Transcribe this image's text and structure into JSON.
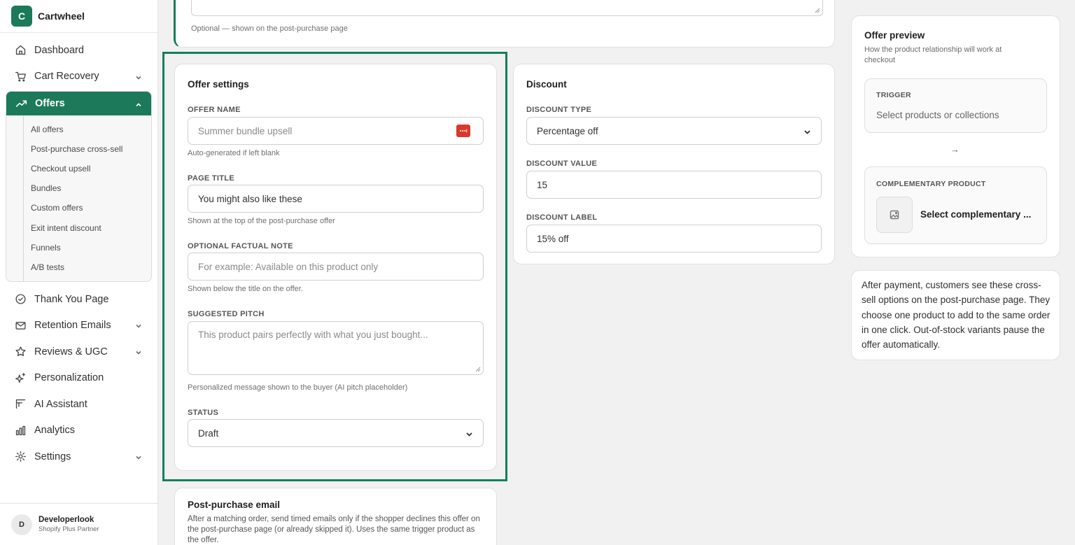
{
  "sidebar": {
    "brand_initial": "C",
    "brand_name": "Cartwheel",
    "items_top": [
      {
        "label": "Dashboard",
        "icon": "home-icon"
      },
      {
        "label": "Cart Recovery",
        "icon": "cart-icon",
        "expandable": true
      }
    ],
    "offers": {
      "label": "Offers",
      "icon": "trend-up-icon",
      "subitems": [
        "All offers",
        "Post-purchase cross-sell",
        "Checkout upsell",
        "Bundles",
        "Custom offers",
        "Exit intent discount",
        "Funnels",
        "A/B tests"
      ]
    },
    "items_bottom": [
      {
        "label": "Thank You Page",
        "icon": "check-circle-icon"
      },
      {
        "label": "Retention Emails",
        "icon": "mail-icon",
        "expandable": true
      },
      {
        "label": "Reviews & UGC",
        "icon": "star-icon",
        "expandable": true
      },
      {
        "label": "Personalization",
        "icon": "sparkle-icon"
      },
      {
        "label": "AI Assistant",
        "icon": "assistant-icon"
      },
      {
        "label": "Analytics",
        "icon": "bar-chart-icon"
      },
      {
        "label": "Settings",
        "icon": "gear-icon",
        "expandable": true
      }
    ],
    "user": {
      "initial": "D",
      "name": "Developerlook",
      "role": "Shopify Plus Partner"
    }
  },
  "top_card": {
    "help": "Optional — shown on the post-purchase page"
  },
  "offer_settings": {
    "title": "Offer settings",
    "offer_name": {
      "label": "Offer name",
      "placeholder": "Summer bundle upsell",
      "help": "Auto-generated if left blank"
    },
    "page_title": {
      "label": "Page title",
      "value": "You might also like these",
      "help": "Shown at the top of the post-purchase offer"
    },
    "factual_note": {
      "label": "Optional factual note",
      "placeholder": "For example: Available on this product only",
      "help": "Shown below the title on the offer."
    },
    "pitch": {
      "label": "Suggested pitch",
      "placeholder": "This product pairs perfectly with what you just bought...",
      "help": "Personalized message shown to the buyer (AI pitch placeholder)"
    },
    "status": {
      "label": "Status",
      "value": "Draft"
    }
  },
  "discount": {
    "title": "Discount",
    "type": {
      "label": "Discount type",
      "value": "Percentage off"
    },
    "value": {
      "label": "Discount value",
      "value": "15"
    },
    "discount_label": {
      "label": "Discount label",
      "value": "15% off"
    }
  },
  "email": {
    "title": "Post-purchase email",
    "description": "After a matching order, send timed emails only if the shopper declines this offer on the post-purchase page (or already skipped it). Uses the same trigger product as the offer."
  },
  "preview": {
    "title": "Offer preview",
    "subtitle": "How the product relationship will work at checkout",
    "trigger_label": "TRIGGER",
    "trigger_value": "Select products or collections",
    "arrow": "→",
    "comp_label": "COMPLEMENTARY PRODUCT",
    "comp_value": "Select complementary ..."
  },
  "info": {
    "text": "After payment, customers see these cross-sell options on the post-purchase page. They choose one product to add to the same order in one click. Out-of-stock variants pause the offer automatically."
  },
  "colors": {
    "accent": "#1c7a5b",
    "focus": "#13805a"
  }
}
